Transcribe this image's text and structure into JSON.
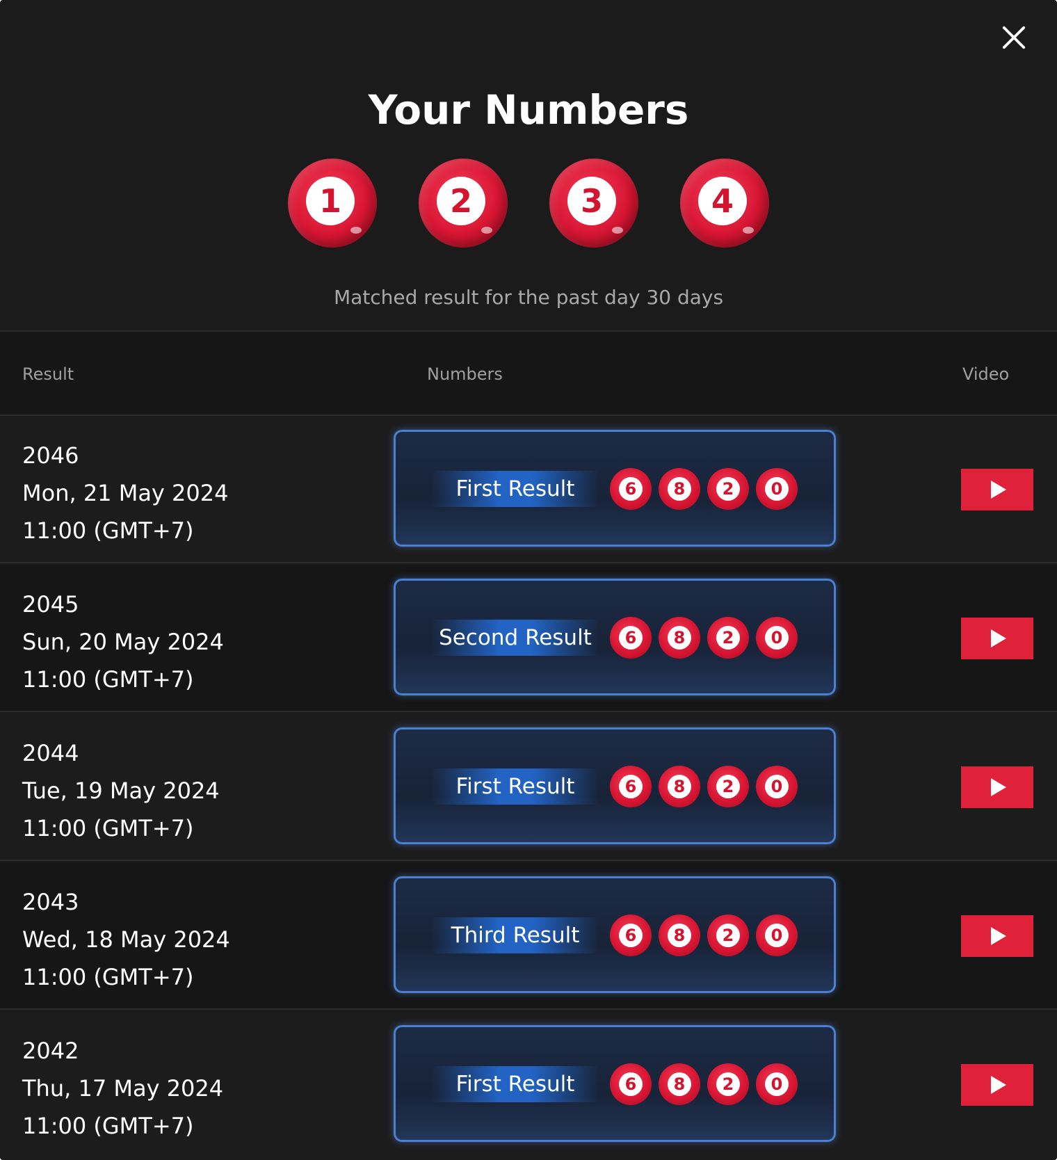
{
  "modal": {
    "title": "Your Numbers",
    "numbers": [
      "1",
      "2",
      "3",
      "4"
    ],
    "subtitle": "Matched result for the past day 30 days"
  },
  "table": {
    "headers": {
      "result": "Result",
      "numbers": "Numbers",
      "video": "Video"
    },
    "rows": [
      {
        "draw": "2046",
        "date": "Mon, 21 May 2024",
        "time": "11:00 (GMT+7)",
        "result_label": "First Result",
        "numbers": [
          "6",
          "8",
          "2",
          "0"
        ]
      },
      {
        "draw": "2045",
        "date": "Sun, 20 May 2024",
        "time": "11:00 (GMT+7)",
        "result_label": "Second Result",
        "numbers": [
          "6",
          "8",
          "2",
          "0"
        ]
      },
      {
        "draw": "2044",
        "date": "Tue, 19 May 2024",
        "time": "11:00 (GMT+7)",
        "result_label": "First Result",
        "numbers": [
          "6",
          "8",
          "2",
          "0"
        ]
      },
      {
        "draw": "2043",
        "date": "Wed, 18 May 2024",
        "time": "11:00 (GMT+7)",
        "result_label": "Third Result",
        "numbers": [
          "6",
          "8",
          "2",
          "0"
        ]
      },
      {
        "draw": "2042",
        "date": "Thu, 17 May 2024",
        "time": "11:00 (GMT+7)",
        "result_label": "First Result",
        "numbers": [
          "6",
          "8",
          "2",
          "0"
        ]
      }
    ]
  },
  "colors": {
    "background": "#1b1b1c",
    "accent_red": "#e0213a",
    "result_border_blue": "#4d7fd0"
  },
  "icons": {
    "close": "close-icon",
    "play": "play-icon"
  }
}
